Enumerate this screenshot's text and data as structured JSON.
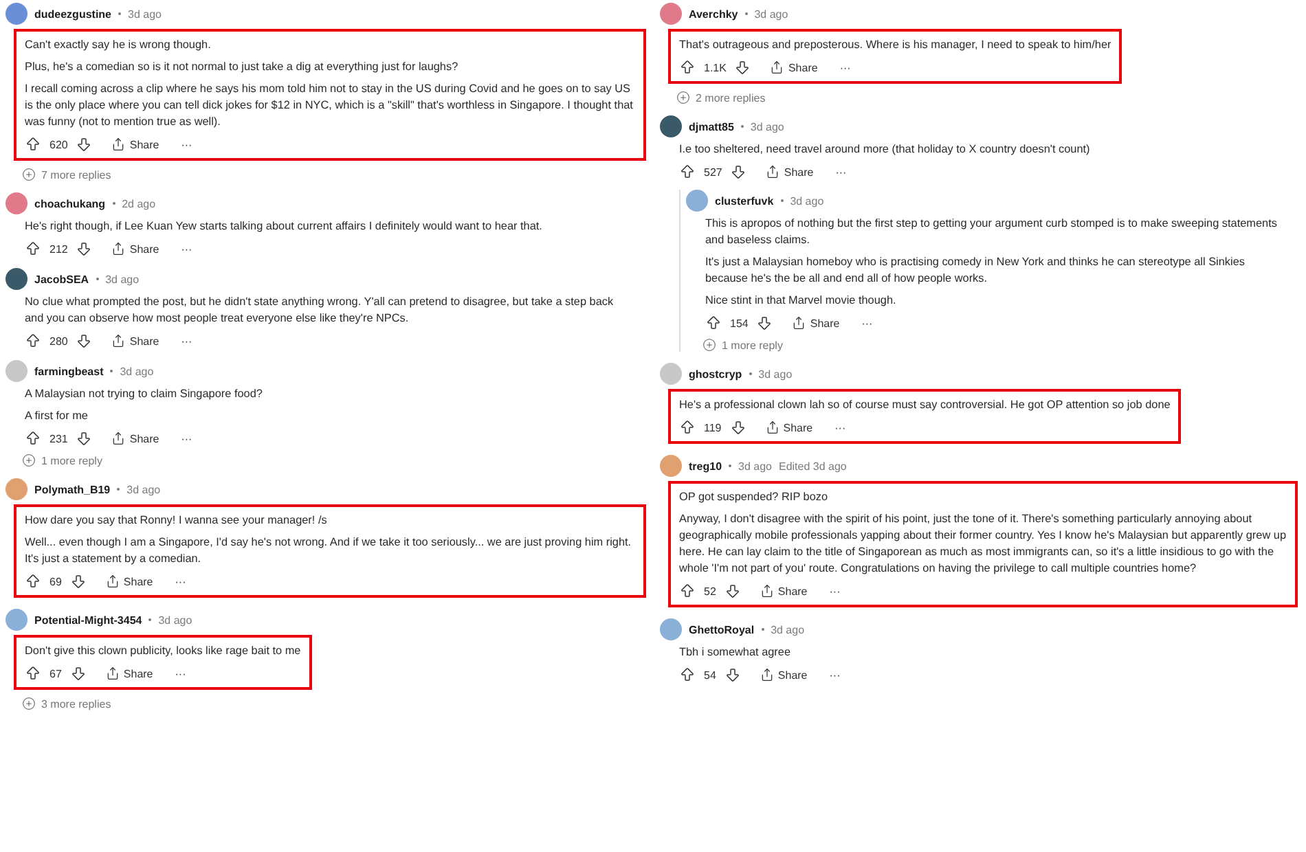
{
  "columns": [
    {
      "comments": [
        {
          "author": "dudeezgustine",
          "time": "3d ago",
          "highlighted": true,
          "paragraphs": [
            "Can't exactly say he is wrong though.",
            "Plus, he's a comedian so is it not normal to just take a dig at everything just for laughs?",
            "I recall coming across a clip where he says his mom told him not to stay in the US during Covid and he goes on to say US is the only place where you can tell dick jokes for $12 in NYC, which is a \"skill\" that's worthless in Singapore. I thought that was funny (not to mention true as well)."
          ],
          "votes": "620",
          "share": "Share",
          "more": "···",
          "more_replies": "7 more replies"
        },
        {
          "author": "choachukang",
          "time": "2d ago",
          "highlighted": false,
          "paragraphs": [
            "He's right though, if Lee Kuan Yew starts talking about current affairs I definitely would want to hear that."
          ],
          "votes": "212",
          "share": "Share",
          "more": "···"
        },
        {
          "author": "JacobSEA",
          "time": "3d ago",
          "highlighted": false,
          "paragraphs": [
            "No clue what prompted the post, but he didn't state anything wrong. Y'all can pretend to disagree, but take a step back and you can observe how most people treat everyone else like they're NPCs."
          ],
          "votes": "280",
          "share": "Share",
          "more": "···"
        },
        {
          "author": "farmingbeast",
          "time": "3d ago",
          "highlighted": false,
          "paragraphs": [
            "A Malaysian not trying to claim Singapore food?",
            "A first for me"
          ],
          "votes": "231",
          "share": "Share",
          "more": "···",
          "more_replies": "1 more reply"
        },
        {
          "author": "Polymath_B19",
          "time": "3d ago",
          "highlighted": true,
          "paragraphs": [
            "How dare you say that Ronny! I wanna see your manager! /s",
            "Well... even though I am a Singapore, I'd say he's not wrong. And if we take it too seriously... we are just proving him right. It's just a statement by a comedian."
          ],
          "votes": "69",
          "share": "Share",
          "more": "···"
        },
        {
          "author": "Potential-Might-3454",
          "time": "3d ago",
          "highlighted": true,
          "paragraphs": [
            "Don't give this clown publicity, looks like rage bait to me"
          ],
          "votes": "67",
          "share": "Share",
          "more": "···",
          "more_replies": "3 more replies"
        }
      ]
    },
    {
      "comments": [
        {
          "author": "Averchky",
          "time": "3d ago",
          "highlighted": true,
          "paragraphs": [
            "That's outrageous and preposterous. Where is his manager, I need to speak to him/her"
          ],
          "votes": "1.1K",
          "share": "Share",
          "more": "···",
          "more_replies": "2 more replies"
        },
        {
          "author": "djmatt85",
          "time": "3d ago",
          "highlighted": false,
          "paragraphs": [
            "I.e too sheltered, need travel around more (that holiday to X country doesn't count)"
          ],
          "votes": "527",
          "share": "Share",
          "more": "···",
          "children": [
            {
              "author": "clusterfuvk",
              "time": "3d ago",
              "highlighted": false,
              "paragraphs": [
                "This is apropos of nothing but the first step to getting your argument curb stomped is to make sweeping statements and baseless claims.",
                "It's just a Malaysian homeboy who is practising comedy in New York and thinks he can stereotype all Sinkies because he's the be all and end all of how people works.",
                "Nice stint in that Marvel movie though."
              ],
              "votes": "154",
              "share": "Share",
              "more": "···",
              "more_replies": "1 more reply"
            }
          ]
        },
        {
          "author": "ghostcryp",
          "time": "3d ago",
          "highlighted": true,
          "paragraphs": [
            "He's a professional clown lah so of course must say controversial. He got OP attention so job done"
          ],
          "votes": "119",
          "share": "Share",
          "more": "···"
        },
        {
          "author": "treg10",
          "time": "3d ago",
          "edited": "Edited 3d ago",
          "highlighted": true,
          "paragraphs": [
            "OP got suspended? RIP bozo",
            "Anyway, I don't disagree with the spirit of his point, just the tone of it. There's something particularly annoying about geographically mobile professionals yapping about their former country. Yes I know he's Malaysian but apparently grew up here. He can lay claim to the title of Singaporean as much as most immigrants can, so it's a little insidious to go with the whole 'I'm not part of you' route. Congratulations on having the privilege to call multiple countries home?"
          ],
          "votes": "52",
          "share": "Share",
          "more": "···"
        },
        {
          "author": "GhettoRoyal",
          "time": "3d ago",
          "highlighted": false,
          "paragraphs": [
            "Tbh i somewhat agree"
          ],
          "votes": "54",
          "share": "Share",
          "more": "···"
        }
      ]
    }
  ]
}
